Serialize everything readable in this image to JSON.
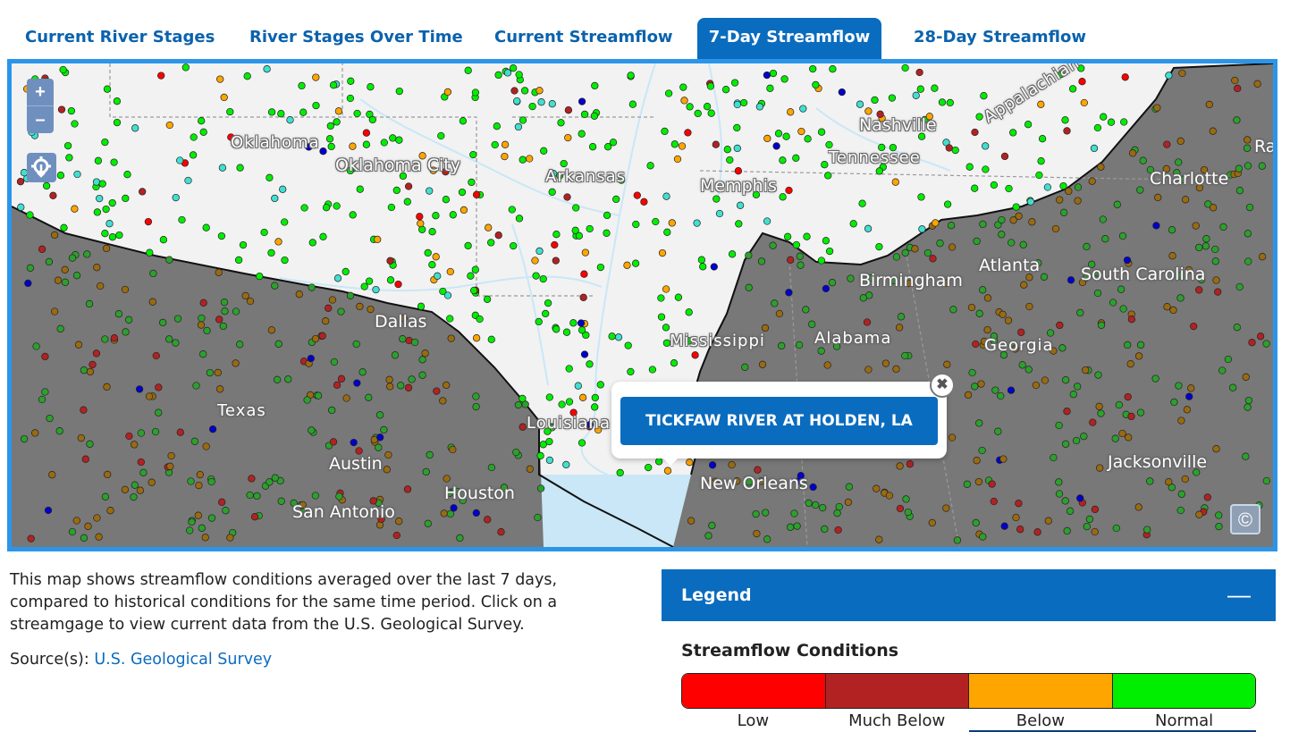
{
  "tabs": [
    {
      "label": "Current River Stages"
    },
    {
      "label": "River Stages Over Time"
    },
    {
      "label": "Current Streamflow"
    },
    {
      "label": "7-Day Streamflow",
      "active": true
    },
    {
      "label": "28-Day Streamflow"
    }
  ],
  "map": {
    "zoom_in": "+",
    "zoom_out": "–",
    "labels": {
      "oklahoma": "Oklahoma",
      "oklahoma_city": "Oklahoma City",
      "arkansas": "Arkansas",
      "memphis": "Memphis",
      "nashville": "Nashville",
      "tennessee": "Tennessee",
      "appalachian": "Appalachian",
      "charlotte": "Charlotte",
      "ra": "Ra",
      "birmingham": "Birmingham",
      "atlanta": "Atlanta",
      "south_carolina": "South Carolina",
      "dallas": "Dallas",
      "mississippi": "Mississippi",
      "alabama": "Alabama",
      "georgia": "Georgia",
      "texas": "Texas",
      "louisiana": "Louisiana",
      "austin": "Austin",
      "houston": "Houston",
      "san_antonio": "San Antonio",
      "new_orleans": "New Orleans",
      "jacksonville": "Jacksonville"
    },
    "popup": {
      "title": "TICKFAW RIVER AT HOLDEN, LA",
      "close": "✖"
    },
    "copyright": "©",
    "colors": {
      "land": "#f2f2f2",
      "drought_area": "#787878",
      "water": "#c9e7f7",
      "low": "#ff0000",
      "much_below": "#b22222",
      "below": "#ffa500",
      "normal": "#00ee00",
      "above": "#40dfd0",
      "much_above": "#0000cd",
      "gray_normal": "#2ca02c",
      "gray_below": "#9a6a10"
    }
  },
  "description": "This map shows streamflow conditions averaged over the last 7 days, compared to historical conditions for the same time period. Click on a streamgage to view current data from the U.S. Geological Survey.",
  "source": {
    "prefix": "Source(s): ",
    "link": "U.S. Geological Survey"
  },
  "legend": {
    "title": "Legend",
    "collapse": "—",
    "section_title": "Streamflow Conditions",
    "scale": [
      {
        "label": "Low",
        "color": "#ff0000"
      },
      {
        "label": "Much Below",
        "color": "#b22222"
      },
      {
        "label": "Below",
        "color": "#ffa500"
      },
      {
        "label": "Normal",
        "color": "#00ee00"
      }
    ]
  }
}
